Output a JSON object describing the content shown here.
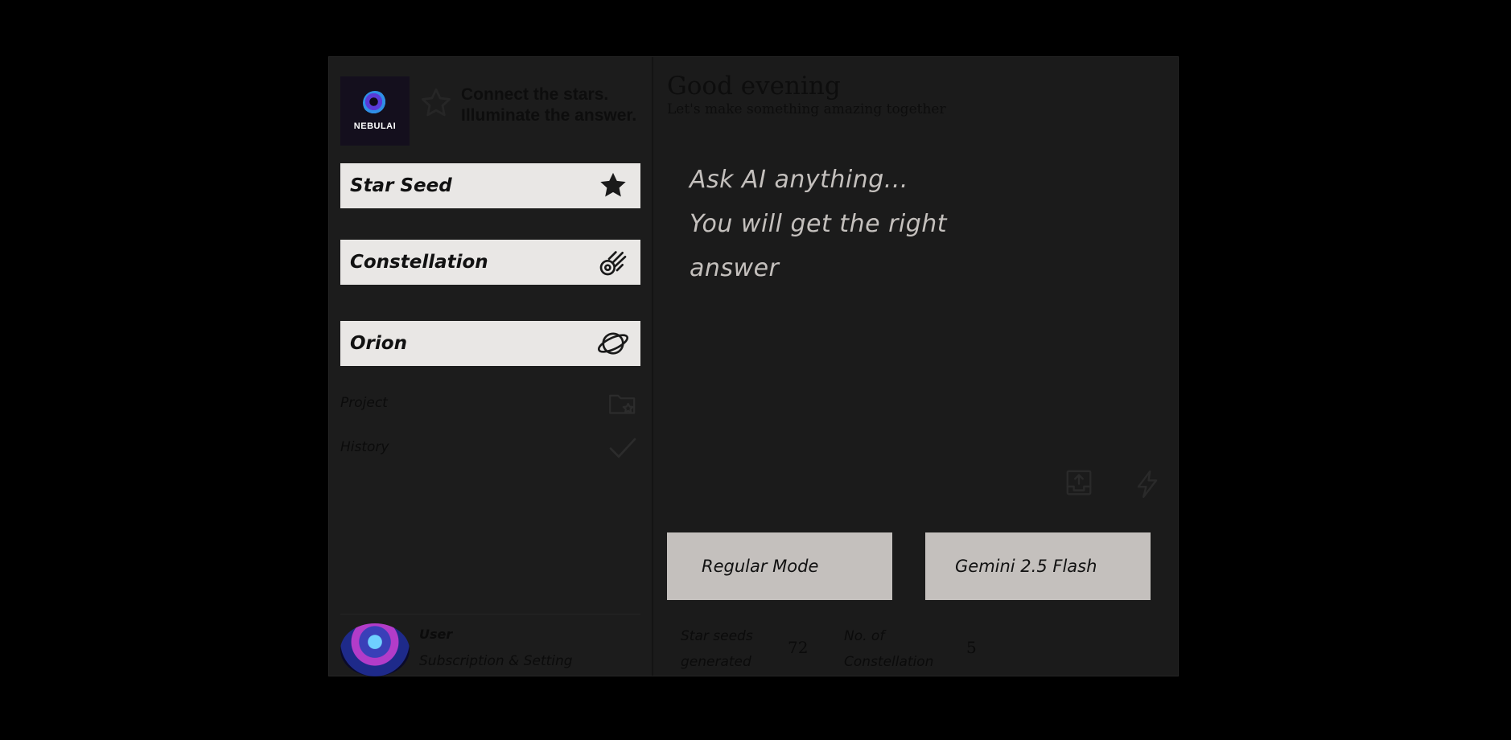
{
  "brand": {
    "logo_text": "NEBULAI"
  },
  "tagline": {
    "line1": "Connect the stars.",
    "line2": "Illuminate the answer."
  },
  "nav": [
    {
      "label": "Star Seed",
      "icon": "star-icon"
    },
    {
      "label": "Constellation",
      "icon": "meteor-icon"
    },
    {
      "label": "Orion",
      "icon": "planet-icon"
    }
  ],
  "links": [
    {
      "label": "Project",
      "icon": "folder-star-icon"
    },
    {
      "label": "History",
      "icon": "check-icon"
    }
  ],
  "user": {
    "name": "User",
    "subtitle": "Subscription & Setting"
  },
  "main": {
    "greeting": "Good evening",
    "subgreeting": "Let's make something amazing together",
    "prompt_line1": "Ask AI anything...",
    "prompt_line2": "You will get the right",
    "prompt_line3": "answer"
  },
  "buttons": {
    "mode": "Regular Mode",
    "model": "Gemini 2.5 Flash"
  },
  "stats": {
    "seeds_label_1": "Star seeds",
    "seeds_label_2": "generated",
    "seeds_value": "72",
    "const_label_1": "No. of",
    "const_label_2": "Constellation",
    "const_value": "5"
  },
  "colors": {
    "background": "#000000",
    "panel": "#1b1b1b",
    "button": "#e9e7e5",
    "mode_button": "#c4c0bd",
    "prompt_text": "#c4c0bd"
  }
}
